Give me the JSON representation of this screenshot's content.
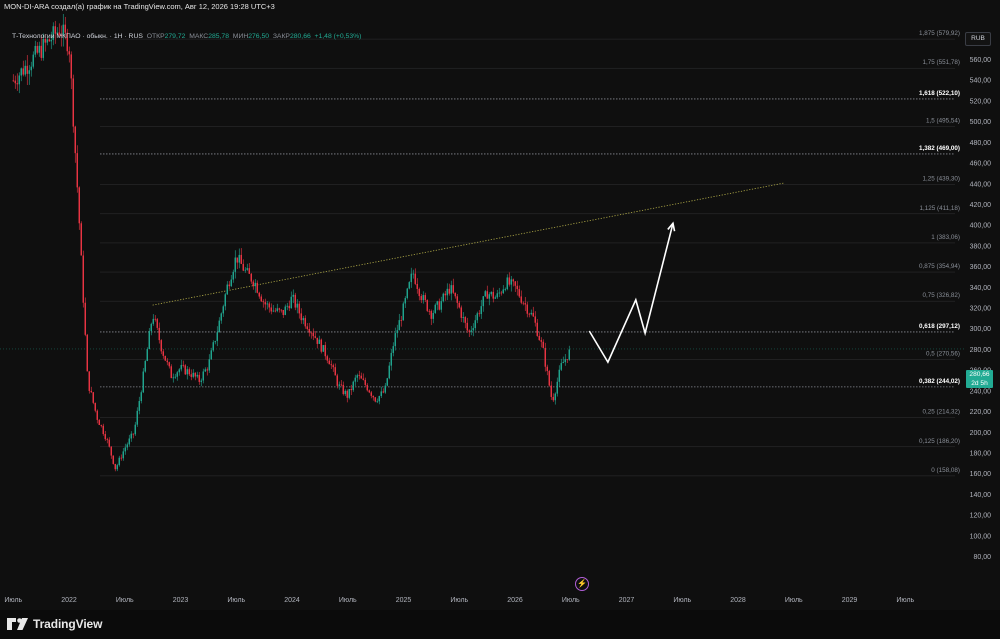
{
  "header": {
    "author_line": "MON-DI-ARA создал(а) график на TradingView.com, Авг 12, 2026 19:28 UTC+3"
  },
  "legend": {
    "symbol": "Т-Технологии МКПАО · обыкн. · 1Н · RUS",
    "open_label": "ОТКР",
    "open": "279,72",
    "high_label": "МАКС",
    "high": "285,78",
    "low_label": "МИН",
    "low": "276,50",
    "close_label": "ЗАКР",
    "close": "280,66",
    "change": "+1,48 (+0,53%)"
  },
  "currency": "RUB",
  "current_price": {
    "value": "280,66",
    "countdown": "2d 5h"
  },
  "colors": {
    "up": "#22ab94",
    "down": "#f23645",
    "fib_line": "#9598a1",
    "trendline": "#b8b24a",
    "projection": "#ffffff",
    "background": "#0f0f0f"
  },
  "price_axis": [
    "580,00",
    "560,00",
    "540,00",
    "520,00",
    "500,00",
    "480,00",
    "460,00",
    "440,00",
    "420,00",
    "400,00",
    "380,00",
    "360,00",
    "340,00",
    "320,00",
    "300,00",
    "280,00",
    "260,00",
    "240,00",
    "220,00",
    "200,00",
    "180,00",
    "160,00",
    "140,00",
    "120,00",
    "100,00",
    "80,00"
  ],
  "time_axis": [
    "Июль",
    "2022",
    "Июль",
    "2023",
    "Июль",
    "2024",
    "Июль",
    "2025",
    "Июль",
    "2026",
    "Июль",
    "2027",
    "Июль",
    "2028",
    "Июль",
    "2029",
    "Июль"
  ],
  "fib_levels": [
    {
      "ratio": "1,875",
      "price": "579,92",
      "key": false
    },
    {
      "ratio": "1,75",
      "price": "551,78",
      "key": false
    },
    {
      "ratio": "1,618",
      "price": "522,10",
      "key": true
    },
    {
      "ratio": "1,5",
      "price": "495,54",
      "key": false
    },
    {
      "ratio": "1,382",
      "price": "469,00",
      "key": true
    },
    {
      "ratio": "1,25",
      "price": "439,30",
      "key": false
    },
    {
      "ratio": "1,125",
      "price": "411,18",
      "key": false
    },
    {
      "ratio": "1",
      "price": "383,06",
      "key": false
    },
    {
      "ratio": "0,875",
      "price": "354,94",
      "key": false
    },
    {
      "ratio": "0,75",
      "price": "326,82",
      "key": false
    },
    {
      "ratio": "0,618",
      "price": "297,12",
      "key": true
    },
    {
      "ratio": "0,5",
      "price": "270,56",
      "key": false
    },
    {
      "ratio": "0,382",
      "price": "244,02",
      "key": true
    },
    {
      "ratio": "0,25",
      "price": "214,32",
      "key": false
    },
    {
      "ratio": "0,125",
      "price": "186,20",
      "key": false
    },
    {
      "ratio": "0",
      "price": "158,08",
      "key": false
    }
  ],
  "price_path": [
    [
      "2021-07",
      540
    ],
    [
      "2021-10",
      570
    ],
    [
      "2021-12",
      590
    ],
    [
      "2022-01",
      575
    ],
    [
      "2022-02",
      420
    ],
    [
      "2022-03",
      250
    ],
    [
      "2022-04",
      215
    ],
    [
      "2022-05",
      195
    ],
    [
      "2022-06",
      165
    ],
    [
      "2022-07",
      185
    ],
    [
      "2022-08",
      200
    ],
    [
      "2022-09",
      255
    ],
    [
      "2022-10",
      315
    ],
    [
      "2022-11",
      280
    ],
    [
      "2022-12",
      255
    ],
    [
      "2023-01",
      262
    ],
    [
      "2023-02",
      258
    ],
    [
      "2023-03",
      250
    ],
    [
      "2023-04",
      265
    ],
    [
      "2023-05",
      300
    ],
    [
      "2023-06",
      340
    ],
    [
      "2023-07",
      370
    ],
    [
      "2023-08",
      355
    ],
    [
      "2023-09",
      345
    ],
    [
      "2023-10",
      325
    ],
    [
      "2023-11",
      318
    ],
    [
      "2023-12",
      315
    ],
    [
      "2024-01",
      330
    ],
    [
      "2024-02",
      312
    ],
    [
      "2024-03",
      300
    ],
    [
      "2024-04",
      285
    ],
    [
      "2024-05",
      270
    ],
    [
      "2024-06",
      245
    ],
    [
      "2024-07",
      235
    ],
    [
      "2024-08",
      255
    ],
    [
      "2024-09",
      245
    ],
    [
      "2024-10",
      232
    ],
    [
      "2024-11",
      240
    ],
    [
      "2024-12",
      290
    ],
    [
      "2025-01",
      320
    ],
    [
      "2025-02",
      355
    ],
    [
      "2025-03",
      330
    ],
    [
      "2025-04",
      315
    ],
    [
      "2025-05",
      325
    ],
    [
      "2025-06",
      340
    ],
    [
      "2025-07",
      320
    ],
    [
      "2025-08",
      295
    ],
    [
      "2025-09",
      315
    ],
    [
      "2025-10",
      335
    ],
    [
      "2025-11",
      330
    ],
    [
      "2025-12",
      345
    ],
    [
      "2026-01",
      340
    ],
    [
      "2026-02",
      325
    ],
    [
      "2026-03",
      310
    ],
    [
      "2026-04",
      280
    ],
    [
      "2026-05",
      230
    ],
    [
      "2026-06",
      265
    ],
    [
      "2026-07",
      280
    ]
  ],
  "projection": [
    [
      "2026-09",
      298
    ],
    [
      "2026-11",
      268
    ],
    [
      "2027-02",
      328
    ],
    [
      "2027-03",
      296
    ],
    [
      "2027-06",
      402
    ]
  ],
  "trendline": [
    [
      "2022-10",
      323
    ],
    [
      "2027-06",
      412
    ],
    [
      "2028-06",
      441
    ]
  ],
  "current_close": 280.66,
  "brand": "TradingView"
}
